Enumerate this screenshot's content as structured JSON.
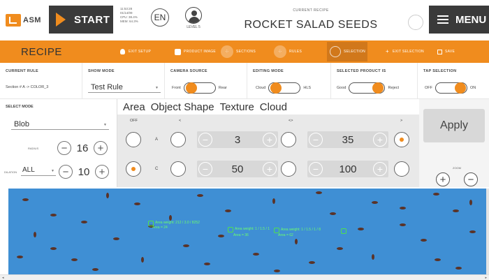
{
  "header": {
    "logo_text": "ASM",
    "start_label": "START",
    "sysinfo": [
      "11:53:28",
      "01/14/09",
      "CPU: 38.4%",
      "MEM: 64.3%"
    ],
    "language": "EN",
    "level_label": "LEVEL 5",
    "recipe_caption": "CURRENT RECIPE",
    "recipe_name": "ROCKET SALAD SEEDS",
    "menu_label": "MENU"
  },
  "recipe_bar": {
    "title": "RECIPE",
    "items": [
      {
        "label": "EXIT SETUP",
        "icon": "bulb-icon"
      },
      {
        "label": "PRODUCT IMAGE",
        "icon": "image-icon"
      },
      {
        "label": "SECTIONS",
        "icon": "sections-icon"
      },
      {
        "label": "RULES",
        "icon": "rules-icon"
      },
      {
        "label": "SELECTION",
        "icon": "selection-icon"
      },
      {
        "label": "EXIT SELECTION",
        "icon": "plus-icon"
      },
      {
        "label": "SAVE",
        "icon": "save-icon"
      }
    ]
  },
  "settings": {
    "current_rule": {
      "caption": "CURRENT RULE",
      "value": "Section # A -> COLOR_3"
    },
    "show_mode": {
      "caption": "SHOW MODE",
      "value": "Test Rule"
    },
    "camera_source": {
      "caption": "CAMERA SOURCE",
      "left": "Front",
      "right": "Rear",
      "state": "front"
    },
    "editing_mode": {
      "caption": "EDITING MODE",
      "left": "Cloud",
      "right": "HLS",
      "state": "cloud"
    },
    "selected_product": {
      "caption": "SELECTED PRODUCT IS",
      "left": "Good",
      "right": "Reject",
      "state": "reject"
    },
    "tap_selection": {
      "caption": "TAP SELECTION",
      "left": "OFF",
      "right": "ON",
      "state": "on"
    }
  },
  "select_mode": {
    "caption": "SELECT MODE",
    "value": "Blob",
    "radius_label": "RADIUS",
    "radius_value": "16",
    "dilation_label": "DILATION",
    "dilation_mode": "ALL",
    "dilation_value": "10"
  },
  "rule_tabs": [
    "Area",
    "Object Shape",
    "Texture",
    "Cloud"
  ],
  "rule_table": {
    "headers": [
      "OFF",
      "<",
      "<>",
      ">"
    ],
    "rows": [
      {
        "label": "A",
        "value1": "3",
        "value2": "35"
      },
      {
        "label": "C",
        "value1": "50",
        "value2": "100"
      }
    ]
  },
  "right_panel": {
    "apply_label": "Apply",
    "zoom_label": "ZOOM"
  },
  "camera": {
    "detections": [
      {
        "line1": "Area weight: 212 / 3.0 / 8252",
        "line2": "Area = 24"
      },
      {
        "line1": "Area weight: 1 / 1.5 / 1",
        "line2": "Area = 36"
      },
      {
        "line1": "Area weight: 1 / 1.5 / 1 / 8",
        "line2": "Area = 62"
      }
    ]
  },
  "colors": {
    "accent": "#f08c1e",
    "dark": "#3a3a3a",
    "camera_bg": "#3f8fd4",
    "seed": "#5a3328",
    "detection": "#4fe04f"
  }
}
